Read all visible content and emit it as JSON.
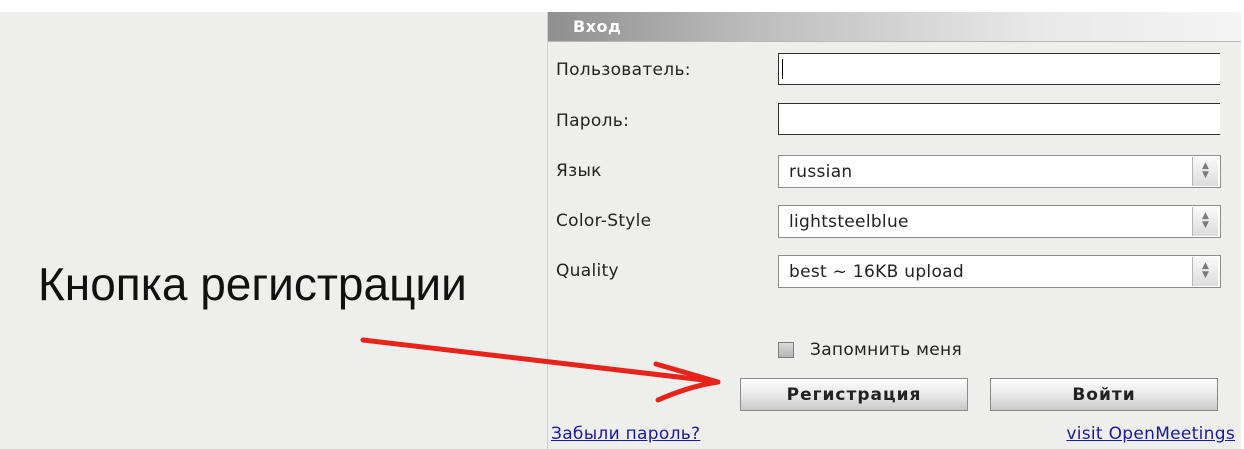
{
  "dialog": {
    "title": "Вход",
    "fields": {
      "username_label": "Пользователь:",
      "username_value": "",
      "password_label": "Пароль:",
      "password_value": "",
      "language_label": "Язык",
      "language_value": "russian",
      "color_style_label": "Color-Style",
      "color_style_value": "lightsteelblue",
      "quality_label": "Quality",
      "quality_value": "best ~ 16KB upload"
    },
    "remember_label": "Запомнить меня",
    "remember_checked": false,
    "register_button": "Регистрация",
    "login_button": "Войти",
    "forgot_password_link": "Забыли пароль?",
    "visit_link": "visit OpenMeetings"
  },
  "annotation": {
    "text": "Кнопка регистрации",
    "arrow_color": "#e8231a"
  },
  "icons": {
    "spinner": "up-down-spinner-icon",
    "arrow": "red-arrow-icon"
  }
}
